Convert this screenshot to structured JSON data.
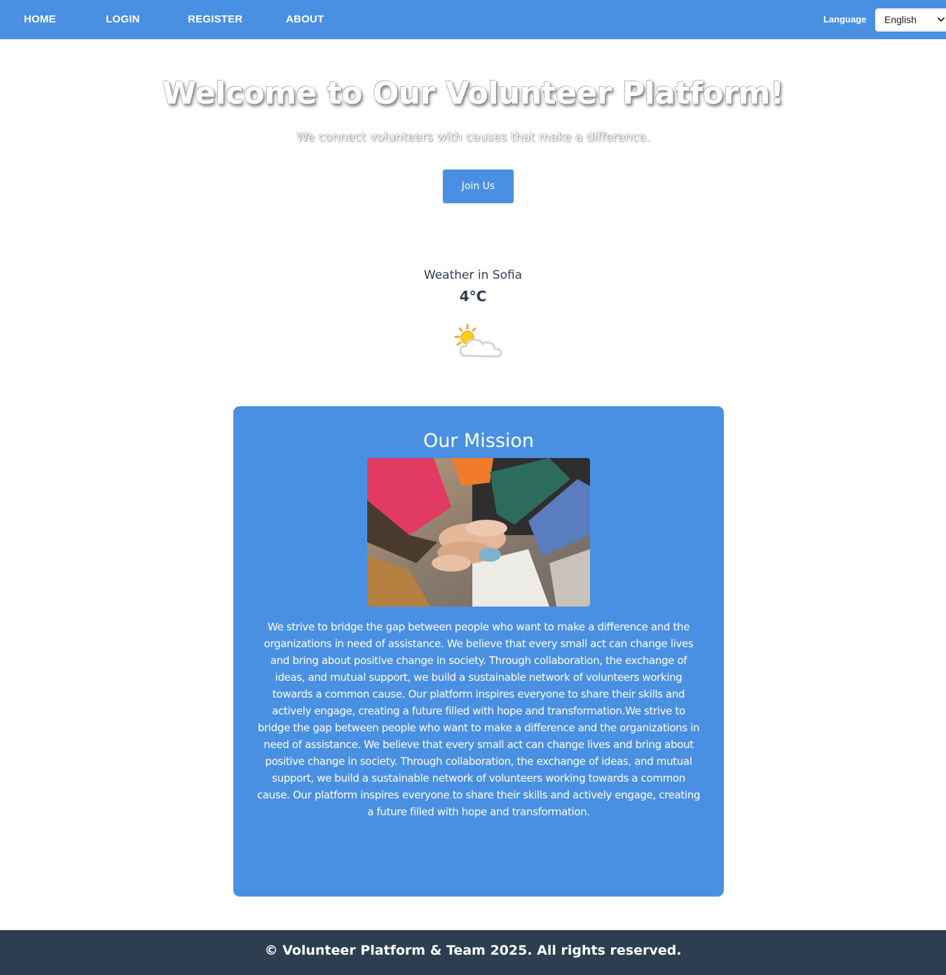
{
  "nav": {
    "home": "HOME",
    "login": "LOGIN",
    "register": "REGISTER",
    "about": "ABOUT",
    "language_label": "Language",
    "language_selected": "English"
  },
  "hero": {
    "title": "Welcome to Our Volunteer Platform!",
    "subtitle": "We connect volunteers with causes that make a difference.",
    "cta_label": "Join Us"
  },
  "weather": {
    "title": "Weather in Sofia",
    "temperature": "4°C",
    "icon": "partly-cloudy-icon"
  },
  "mission": {
    "title": "Our Mission",
    "image": "hands-together-photo",
    "text": "We strive to bridge the gap between people who want to make a difference and the organizations in need of assistance. We believe that every small act can change lives and bring about positive change in society. Through collaboration, the exchange of ideas, and mutual support, we build a sustainable network of volunteers working towards a common cause. Our platform inspires everyone to share their skills and actively engage, creating a future filled with hope and transformation.We strive to bridge the gap between people who want to make a difference and the organizations in need of assistance. We believe that every small act can change lives and bring about positive change in society. Through collaboration, the exchange of ideas, and mutual support, we build a sustainable network of volunteers working towards a common cause. Our platform inspires everyone to share their skills and actively engage, creating a future filled with hope and transformation."
  },
  "footer": {
    "text": "© Volunteer Platform & Team 2025. All rights reserved."
  },
  "colors": {
    "primary": "#4a90e2",
    "dark": "#2c3e50",
    "white": "#ffffff"
  }
}
